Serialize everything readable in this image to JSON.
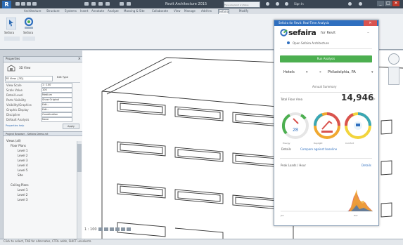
{
  "titlebar": {
    "app_logo": "R",
    "title": "Revit Architecture 2015",
    "search_placeholder": "Type a keyword or phrase",
    "signin": "Sign In",
    "controls": [
      "_",
      "□",
      "✕"
    ]
  },
  "ribbon": {
    "tabs": [
      "Architecture",
      "Structure",
      "Systems",
      "Insert",
      "Annotate",
      "Analyze",
      "Massing & Site",
      "Collaborate",
      "View",
      "Manage",
      "Add-Ins",
      "Sefaira",
      "Modify"
    ],
    "active_tab": "Sefaira",
    "tools": [
      {
        "label": "Sefaira",
        "icon": "pointer-icon"
      },
      {
        "label": "Sefaira",
        "icon": "sefaira-icon"
      }
    ]
  },
  "left_pane": {
    "properties_title": "Properties",
    "type_selector": "3D View",
    "view_dropdown": "3D View: {3D}",
    "edit_type": "Edit Type",
    "rows": [
      {
        "label": "View Scale",
        "value": "1 : 100"
      },
      {
        "label": "Scale Value",
        "value": "100"
      },
      {
        "label": "Detail Level",
        "value": "Medium"
      },
      {
        "label": "Parts Visibility",
        "value": "Show Original"
      },
      {
        "label": "Visibility/Graphics",
        "value": "Edit..."
      },
      {
        "label": "Graphic Display",
        "value": "Edit..."
      },
      {
        "label": "Discipline",
        "value": "Coordination"
      },
      {
        "label": "Default Analysis",
        "value": "None"
      }
    ],
    "help_link": "Properties help",
    "apply": "Apply",
    "browser_title": "Project Browser - Sefaira Demo.rvt",
    "tree": [
      "Views (all)",
      "Floor Plans",
      "Level 1",
      "Level 2",
      "Level 3",
      "Level 4",
      "Level 5",
      "Site",
      "Ceiling Plans",
      "Level 1",
      "Level 2",
      "Level 3"
    ]
  },
  "sefaira": {
    "window_title": "Sefaira for Revit: Real-Time Analysis",
    "brand": "sefaira",
    "brand_sub": "for Revit",
    "open_link": "Open Sefaira Architecture",
    "analyze_button": "Run Analysis",
    "select_1": "Hotels",
    "select_2": "Philadelphia, PA",
    "mid_label": "Annual Summary",
    "total_label": "Total Floor Area",
    "total_value": "14,946",
    "total_unit": "m²",
    "ring_center_value": "28",
    "ring_labels": [
      "Energy",
      "Daylight",
      "Comfort"
    ],
    "footer_left": "Details",
    "footer_right": "Compare against baseline",
    "chart_label": "Peak Loads / Hour",
    "chart_link": "Details",
    "axis_left": "Jan",
    "axis_right": "Dec",
    "colors": {
      "green": "#4caf50",
      "red": "#d9534f",
      "blue": "#2f6fbf",
      "orange": "#f0a830",
      "yellow": "#f2d43c",
      "teal": "#3aa7b5"
    }
  },
  "status": {
    "text": "Click to select, TAB for alternates, CTRL adds, SHIFT unselects.",
    "scale": "1 : 100"
  }
}
